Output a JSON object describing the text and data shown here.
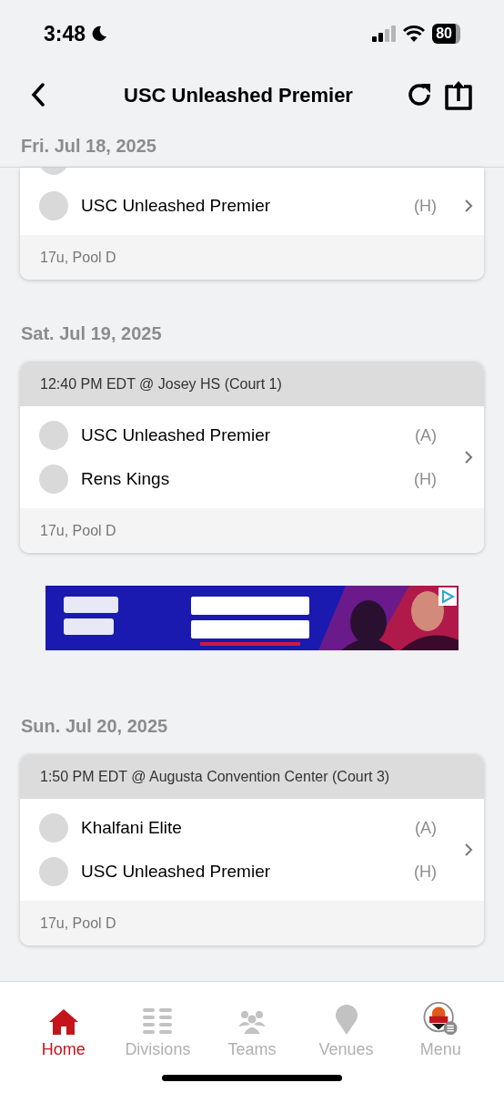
{
  "status_bar": {
    "time": "3:48",
    "battery": "80"
  },
  "nav": {
    "title": "USC Unleashed Premier"
  },
  "sections": [
    {
      "kind": "day",
      "date": "Fri. Jul 18, 2025",
      "clipped": true,
      "games": [
        {
          "teams": [
            {
              "name": "USC Unleashed Premier",
              "side": "(H)"
            }
          ],
          "footer": "17u, Pool D"
        }
      ]
    },
    {
      "kind": "day",
      "date": "Sat. Jul 19, 2025",
      "clipped": false,
      "games": [
        {
          "header": "12:40 PM EDT @ Josey HS (Court 1)",
          "teams": [
            {
              "name": "USC Unleashed Premier",
              "side": "(A)"
            },
            {
              "name": "Rens Kings",
              "side": "(H)"
            }
          ],
          "footer": "17u, Pool D"
        }
      ]
    },
    {
      "kind": "ad"
    },
    {
      "kind": "day",
      "date": "Sun. Jul 20, 2025",
      "clipped": false,
      "games": [
        {
          "header": "1:50 PM EDT @ Augusta Convention Center (Court 3)",
          "teams": [
            {
              "name": "Khalfani Elite",
              "side": "(A)"
            },
            {
              "name": "USC Unleashed Premier",
              "side": "(H)"
            }
          ],
          "footer": "17u, Pool D"
        }
      ]
    }
  ],
  "tabs": [
    {
      "label": "Home",
      "selected": true,
      "kind": "home"
    },
    {
      "label": "Divisions",
      "selected": false,
      "kind": "divisions"
    },
    {
      "label": "Teams",
      "selected": false,
      "kind": "teams"
    },
    {
      "label": "Venues",
      "selected": false,
      "kind": "venues"
    },
    {
      "label": "Menu",
      "selected": false,
      "kind": "menu"
    }
  ]
}
